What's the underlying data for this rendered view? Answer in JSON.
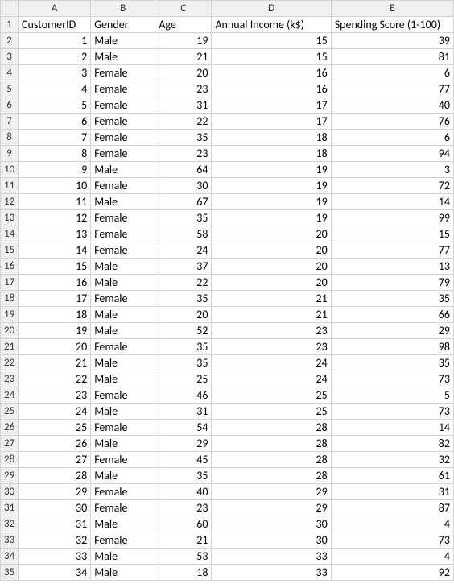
{
  "columns": [
    "A",
    "B",
    "C",
    "D",
    "E"
  ],
  "headers": {
    "A": "CustomerID",
    "B": "Gender",
    "C": "Age",
    "D": "Annual Income (k$)",
    "E": "Spending Score (1-100)"
  },
  "rows": [
    {
      "r": 2,
      "A": 1,
      "B": "Male",
      "C": 19,
      "D": 15,
      "E": 39
    },
    {
      "r": 3,
      "A": 2,
      "B": "Male",
      "C": 21,
      "D": 15,
      "E": 81
    },
    {
      "r": 4,
      "A": 3,
      "B": "Female",
      "C": 20,
      "D": 16,
      "E": 6
    },
    {
      "r": 5,
      "A": 4,
      "B": "Female",
      "C": 23,
      "D": 16,
      "E": 77
    },
    {
      "r": 6,
      "A": 5,
      "B": "Female",
      "C": 31,
      "D": 17,
      "E": 40
    },
    {
      "r": 7,
      "A": 6,
      "B": "Female",
      "C": 22,
      "D": 17,
      "E": 76
    },
    {
      "r": 8,
      "A": 7,
      "B": "Female",
      "C": 35,
      "D": 18,
      "E": 6
    },
    {
      "r": 9,
      "A": 8,
      "B": "Female",
      "C": 23,
      "D": 18,
      "E": 94
    },
    {
      "r": 10,
      "A": 9,
      "B": "Male",
      "C": 64,
      "D": 19,
      "E": 3
    },
    {
      "r": 11,
      "A": 10,
      "B": "Female",
      "C": 30,
      "D": 19,
      "E": 72
    },
    {
      "r": 12,
      "A": 11,
      "B": "Male",
      "C": 67,
      "D": 19,
      "E": 14
    },
    {
      "r": 13,
      "A": 12,
      "B": "Female",
      "C": 35,
      "D": 19,
      "E": 99
    },
    {
      "r": 14,
      "A": 13,
      "B": "Female",
      "C": 58,
      "D": 20,
      "E": 15
    },
    {
      "r": 15,
      "A": 14,
      "B": "Female",
      "C": 24,
      "D": 20,
      "E": 77
    },
    {
      "r": 16,
      "A": 15,
      "B": "Male",
      "C": 37,
      "D": 20,
      "E": 13
    },
    {
      "r": 17,
      "A": 16,
      "B": "Male",
      "C": 22,
      "D": 20,
      "E": 79
    },
    {
      "r": 18,
      "A": 17,
      "B": "Female",
      "C": 35,
      "D": 21,
      "E": 35
    },
    {
      "r": 19,
      "A": 18,
      "B": "Male",
      "C": 20,
      "D": 21,
      "E": 66
    },
    {
      "r": 20,
      "A": 19,
      "B": "Male",
      "C": 52,
      "D": 23,
      "E": 29
    },
    {
      "r": 21,
      "A": 20,
      "B": "Female",
      "C": 35,
      "D": 23,
      "E": 98
    },
    {
      "r": 22,
      "A": 21,
      "B": "Male",
      "C": 35,
      "D": 24,
      "E": 35
    },
    {
      "r": 23,
      "A": 22,
      "B": "Male",
      "C": 25,
      "D": 24,
      "E": 73
    },
    {
      "r": 24,
      "A": 23,
      "B": "Female",
      "C": 46,
      "D": 25,
      "E": 5
    },
    {
      "r": 25,
      "A": 24,
      "B": "Male",
      "C": 31,
      "D": 25,
      "E": 73
    },
    {
      "r": 26,
      "A": 25,
      "B": "Female",
      "C": 54,
      "D": 28,
      "E": 14
    },
    {
      "r": 27,
      "A": 26,
      "B": "Male",
      "C": 29,
      "D": 28,
      "E": 82
    },
    {
      "r": 28,
      "A": 27,
      "B": "Female",
      "C": 45,
      "D": 28,
      "E": 32
    },
    {
      "r": 29,
      "A": 28,
      "B": "Male",
      "C": 35,
      "D": 28,
      "E": 61
    },
    {
      "r": 30,
      "A": 29,
      "B": "Female",
      "C": 40,
      "D": 29,
      "E": 31
    },
    {
      "r": 31,
      "A": 30,
      "B": "Female",
      "C": 23,
      "D": 29,
      "E": 87
    },
    {
      "r": 32,
      "A": 31,
      "B": "Male",
      "C": 60,
      "D": 30,
      "E": 4
    },
    {
      "r": 33,
      "A": 32,
      "B": "Female",
      "C": 21,
      "D": 30,
      "E": 73
    },
    {
      "r": 34,
      "A": 33,
      "B": "Male",
      "C": 53,
      "D": 33,
      "E": 4
    },
    {
      "r": 35,
      "A": 34,
      "B": "Male",
      "C": 18,
      "D": 33,
      "E": 92
    }
  ],
  "chart_data": {
    "type": "table",
    "title": "",
    "columns": [
      "CustomerID",
      "Gender",
      "Age",
      "Annual Income (k$)",
      "Spending Score (1-100)"
    ],
    "data": [
      [
        1,
        "Male",
        19,
        15,
        39
      ],
      [
        2,
        "Male",
        21,
        15,
        81
      ],
      [
        3,
        "Female",
        20,
        16,
        6
      ],
      [
        4,
        "Female",
        23,
        16,
        77
      ],
      [
        5,
        "Female",
        31,
        17,
        40
      ],
      [
        6,
        "Female",
        22,
        17,
        76
      ],
      [
        7,
        "Female",
        35,
        18,
        6
      ],
      [
        8,
        "Female",
        23,
        18,
        94
      ],
      [
        9,
        "Male",
        64,
        19,
        3
      ],
      [
        10,
        "Female",
        30,
        19,
        72
      ],
      [
        11,
        "Male",
        67,
        19,
        14
      ],
      [
        12,
        "Female",
        35,
        19,
        99
      ],
      [
        13,
        "Female",
        58,
        20,
        15
      ],
      [
        14,
        "Female",
        24,
        20,
        77
      ],
      [
        15,
        "Male",
        37,
        20,
        13
      ],
      [
        16,
        "Male",
        22,
        20,
        79
      ],
      [
        17,
        "Female",
        35,
        21,
        35
      ],
      [
        18,
        "Male",
        20,
        21,
        66
      ],
      [
        19,
        "Male",
        52,
        23,
        29
      ],
      [
        20,
        "Female",
        35,
        23,
        98
      ],
      [
        21,
        "Male",
        35,
        24,
        35
      ],
      [
        22,
        "Male",
        25,
        24,
        73
      ],
      [
        23,
        "Female",
        46,
        25,
        5
      ],
      [
        24,
        "Male",
        31,
        25,
        73
      ],
      [
        25,
        "Female",
        54,
        28,
        14
      ],
      [
        26,
        "Male",
        29,
        28,
        82
      ],
      [
        27,
        "Female",
        45,
        28,
        32
      ],
      [
        28,
        "Male",
        35,
        28,
        61
      ],
      [
        29,
        "Female",
        40,
        29,
        31
      ],
      [
        30,
        "Female",
        23,
        29,
        87
      ],
      [
        31,
        "Male",
        60,
        30,
        4
      ],
      [
        32,
        "Female",
        21,
        30,
        73
      ],
      [
        33,
        "Male",
        53,
        33,
        4
      ],
      [
        34,
        "Male",
        18,
        33,
        92
      ]
    ]
  }
}
